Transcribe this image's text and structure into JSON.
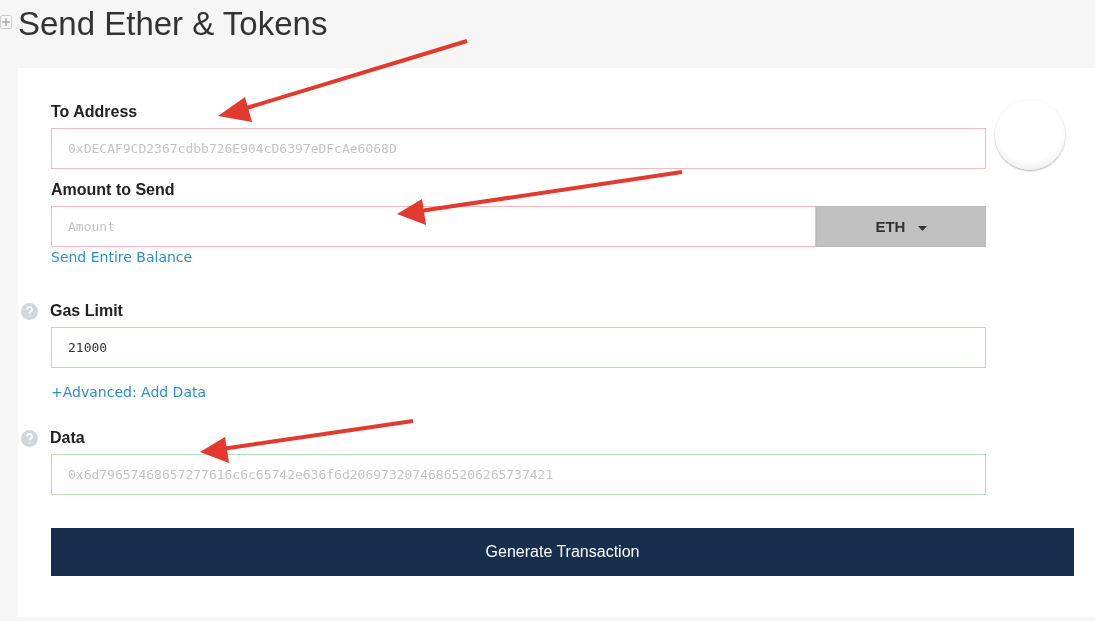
{
  "title": "Send Ether & Tokens",
  "to_address": {
    "label": "To Address",
    "placeholder": "0xDECAF9CD2367cdbb726E904cD6397eDFcAe6068D",
    "valid": false
  },
  "amount": {
    "label": "Amount to Send",
    "placeholder": "Amount",
    "valid": false,
    "unit": "ETH",
    "link": "Send Entire Balance"
  },
  "gas_limit": {
    "label": "Gas Limit",
    "value": "21000",
    "valid": true,
    "link": "+Advanced: Add Data"
  },
  "data": {
    "label": "Data",
    "placeholder": "0x6d79657468657277616c6c65742e636f6d20697320746865206265737421",
    "valid": true
  },
  "button": "Generate Transaction"
}
